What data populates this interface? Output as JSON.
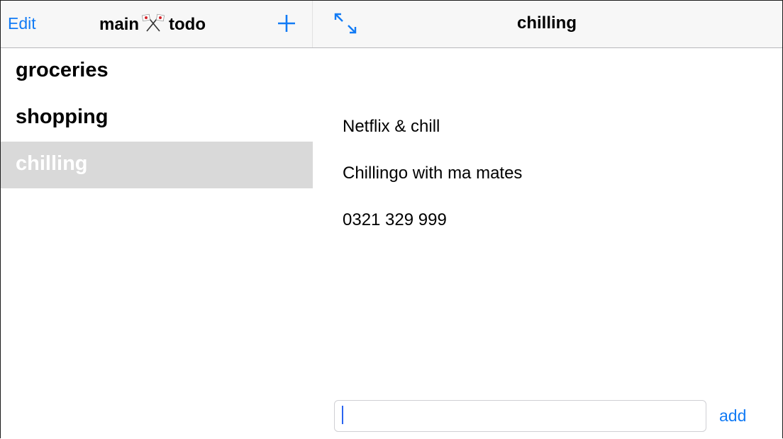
{
  "navbar": {
    "edit_label": "Edit",
    "title_left": "main",
    "title_right": "todo",
    "title_icon": "crossed-flags-icon",
    "add_icon": "plus-icon",
    "expand_icon": "expand-arrows-icon",
    "detail_title": "chilling"
  },
  "lists": [
    {
      "label": "groceries",
      "selected": false
    },
    {
      "label": "shopping",
      "selected": false
    },
    {
      "label": "chilling",
      "selected": true
    }
  ],
  "detail": {
    "items": [
      "Netflix & chill",
      "Chillingo with ma mates",
      "0321 329 999"
    ]
  },
  "footer": {
    "input_value": "",
    "add_label": "add"
  },
  "colors": {
    "accent": "#127bf5",
    "selected_row": "#d9d9d9",
    "navbar_bg": "#f7f7f7"
  }
}
